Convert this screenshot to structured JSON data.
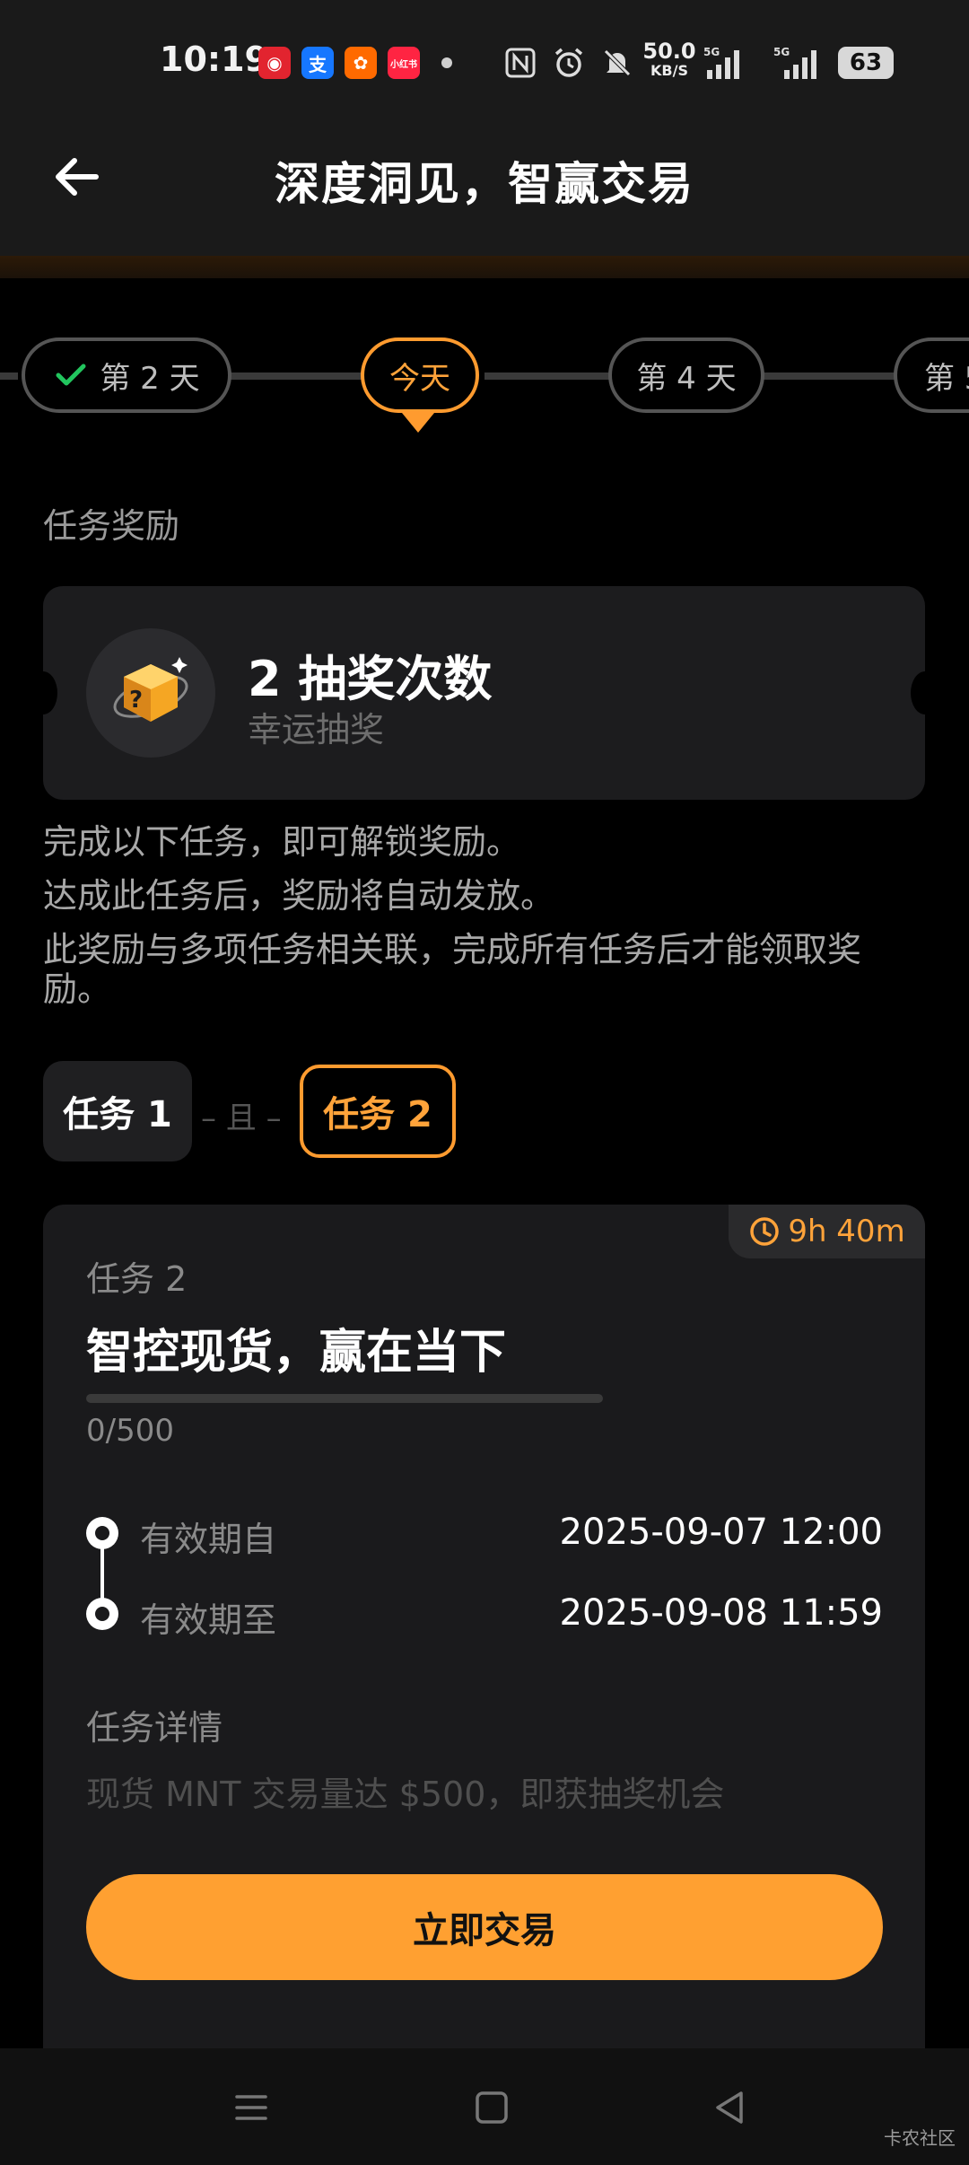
{
  "status_bar": {
    "time": "10:19",
    "net_speed": "50.0",
    "net_speed_unit": "KB/S",
    "signal_1": "5G",
    "signal_2": "5G",
    "battery": "63",
    "app_icons": [
      {
        "name": "bank-app-icon",
        "color": "#e2242f",
        "glyph": "◉"
      },
      {
        "name": "alipay-app-icon",
        "color": "#1677ff",
        "glyph": "支"
      },
      {
        "name": "taobao-app-icon",
        "color": "#ff6a00",
        "glyph": "✿"
      },
      {
        "name": "xiaohongshu-app-icon",
        "color": "#ff2442",
        "glyph": "小红书"
      }
    ]
  },
  "header": {
    "title": "深度洞见，智赢交易"
  },
  "day_stepper": {
    "days": [
      {
        "label": "第 2 天",
        "state": "completed"
      },
      {
        "label": "今天",
        "state": "active"
      },
      {
        "label": "第 4 天",
        "state": "upcoming"
      },
      {
        "label": "第 5",
        "state": "upcoming"
      }
    ]
  },
  "reward": {
    "section_label": "任务奖励",
    "title": "2 抽奖次数",
    "subtitle": "幸运抽奖"
  },
  "description": {
    "line1": "完成以下任务，即可解锁奖励。",
    "line2": "达成此任务后，奖励将自动发放。",
    "line3": "此奖励与多项任务相关联，完成所有任务后才能领取奖励。"
  },
  "task_tabs": {
    "tab1": "任务 1",
    "join": "– 且 –",
    "tab2": "任务 2"
  },
  "task": {
    "timer": "9h 40m",
    "number": "任务 2",
    "name": "智控现货，赢在当下",
    "progress_text": "0/500",
    "progress_fraction": 0,
    "valid_from_label": "有效期自",
    "valid_from": "2025-09-07 12:00",
    "valid_to_label": "有效期至",
    "valid_to": "2025-09-08 11:59",
    "detail_label": "任务详情",
    "detail_text": "现货 MNT 交易量达 $500，即获抽奖机会",
    "button": "立即交易"
  },
  "colors": {
    "accent": "#ffa031",
    "check": "#22c55e"
  },
  "watermark": "卡农社区"
}
